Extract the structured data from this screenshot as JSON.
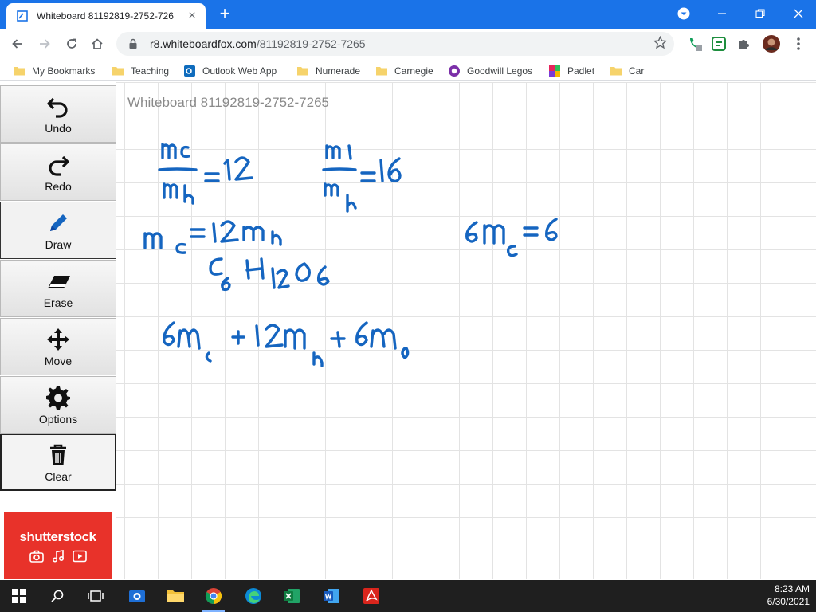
{
  "browser": {
    "tab_title": "Whiteboard 81192819-2752-726",
    "url_host": "r8.whiteboardfox.com",
    "url_path": "/81192819-2752-7265",
    "bookmarks": [
      {
        "label": "My Bookmarks",
        "icon": "folder-icon"
      },
      {
        "label": "Teaching",
        "icon": "folder-icon"
      },
      {
        "label": "Outlook Web App",
        "icon": "outlook-icon"
      },
      {
        "label": "Numerade",
        "icon": "folder-icon"
      },
      {
        "label": "Carnegie",
        "icon": "folder-icon"
      },
      {
        "label": "Goodwill Legos",
        "icon": "goodwill-icon"
      },
      {
        "label": "Padlet",
        "icon": "padlet-icon"
      },
      {
        "label": "Car",
        "icon": "folder-icon"
      }
    ]
  },
  "whiteboard": {
    "title": "Whiteboard 81192819-2752-7265",
    "tools": [
      {
        "label": "Undo",
        "icon": "undo-icon"
      },
      {
        "label": "Redo",
        "icon": "redo-icon"
      },
      {
        "label": "Draw",
        "icon": "pencil-icon"
      },
      {
        "label": "Erase",
        "icon": "eraser-icon"
      },
      {
        "label": "Move",
        "icon": "move-icon"
      },
      {
        "label": "Options",
        "icon": "gear-icon"
      },
      {
        "label": "Clear",
        "icon": "trash-icon"
      }
    ],
    "ink_color": "#1565c0",
    "handwriting": [
      "mc/mh = 12",
      "mo/mh = 16",
      "mc = 12 mh",
      "C6 H12 O6",
      "6mc = 6",
      "6mc + 12mh + 6mo"
    ]
  },
  "ad": {
    "brand": "shutterstock"
  },
  "taskbar": {
    "time": "8:23 AM",
    "date": "6/30/2021"
  }
}
